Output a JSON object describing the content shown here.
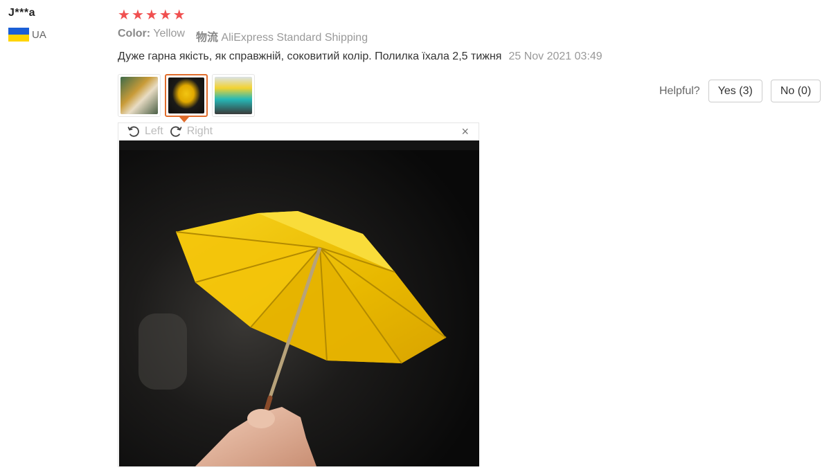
{
  "reviewer": {
    "name": "J***a",
    "country": "UA",
    "flag_colors": [
      "#1b5fd6",
      "#ffd400"
    ]
  },
  "review": {
    "rating": 5,
    "star_color": "#f05050",
    "color_label": "Color:",
    "color_value": "Yellow",
    "shipping_label": "物流",
    "shipping_value": "AliExpress Standard Shipping",
    "text": "Дуже гарна якість, як справжній, соковитий колір. Полилка їхала 2,5 тижня",
    "date": "25 Nov 2021 03:49"
  },
  "images": {
    "thumbnails": [
      "thumb-1",
      "thumb-2",
      "thumb-3"
    ],
    "active_index": 1,
    "active_border_color": "#e06c2b"
  },
  "viewer": {
    "rotate_left_label": "Left",
    "rotate_right_label": "Right",
    "close_glyph": "×"
  },
  "helpful": {
    "label": "Helpful?",
    "yes_label": "Yes (3)",
    "no_label": "No (0)"
  }
}
